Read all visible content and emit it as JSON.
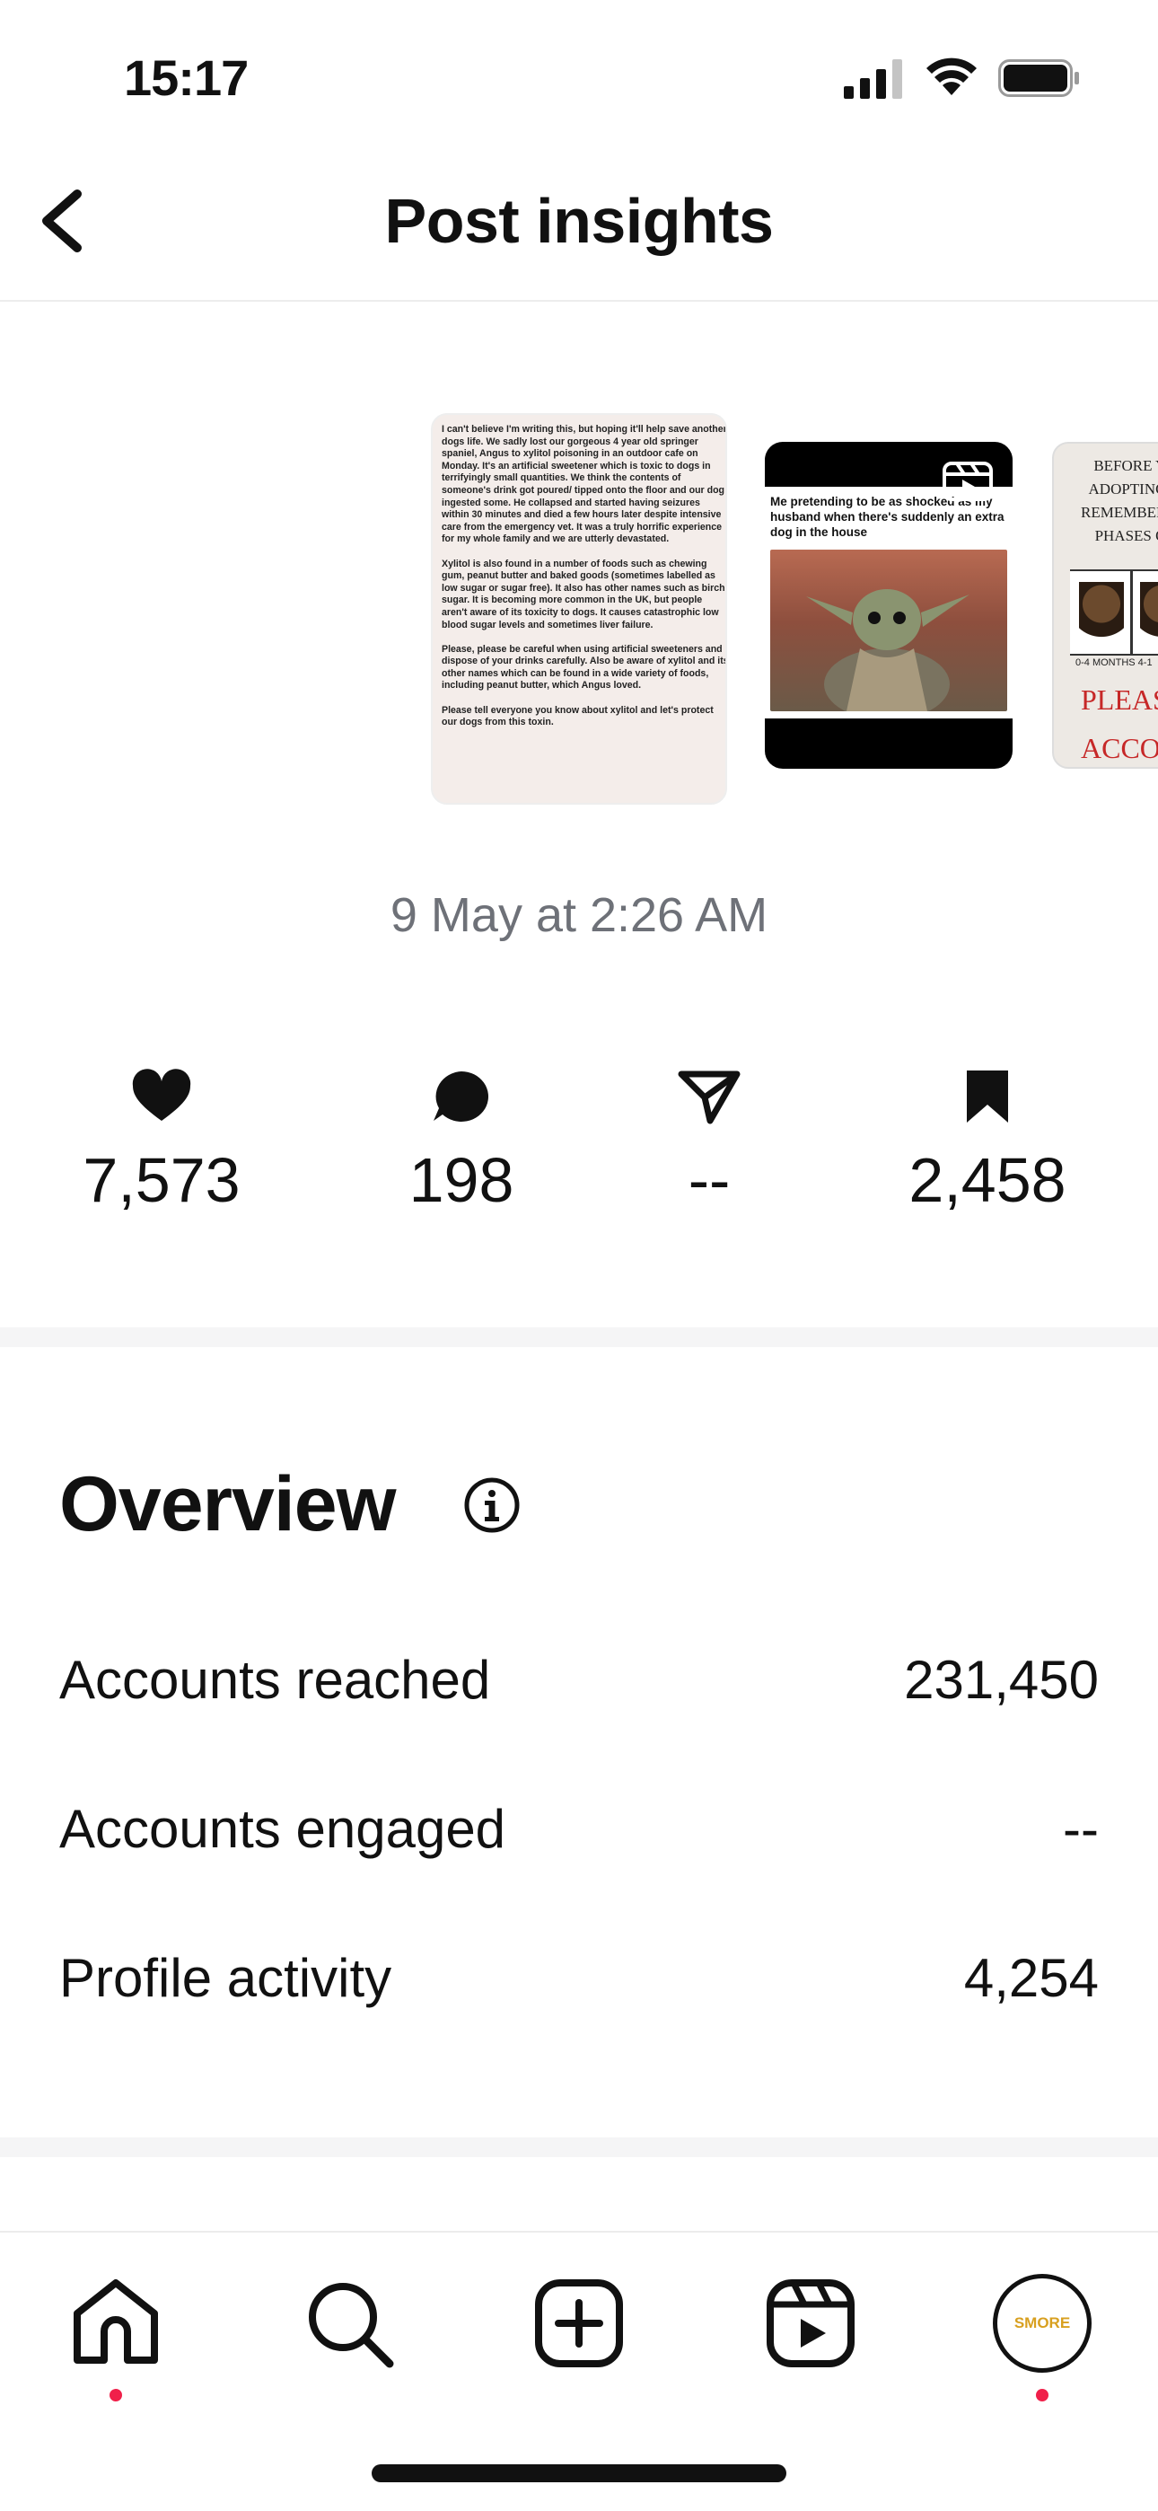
{
  "status_bar": {
    "time": "15:17"
  },
  "header": {
    "title": "Post insights"
  },
  "thumbnails": [
    {
      "text": "I can't believe I'm writing this, but hoping it'll help save another dogs life. We sadly lost our gorgeous 4 year old springer spaniel, Angus to xylitol poisoning in an outdoor cafe on Monday. It's an artificial sweetener which is toxic to dogs in terrifyingly small quantities. We think the contents of someone's drink got poured/ tipped onto the floor and our dog ingested some. He collapsed and started having seizures within 30 minutes and died a few hours later despite intensive care from the emergency vet. It was a truly horrific experience for my whole family and we are utterly devastated.\n\nXylitol is also found in a number of foods such as chewing gum, peanut butter and baked goods (sometimes labelled as low sugar or sugar free). It also has other names such as birch sugar. It is becoming more common in the UK, but people aren't aware of its toxicity to dogs. It causes catastrophic low blood sugar levels and sometimes liver failure.\n\nPlease, please be careful when using artificial sweeteners and dispose of your drinks carefully. Also be aware of xylitol and its other names which can be found in a wide variety of foods, including peanut butter, which Angus loved.\n\nPlease tell everyone you know about xylitol and let's protect our dogs from this toxin."
    },
    {
      "caption": "Me pretending to be as shocked as my husband when there's suddenly an extra dog in the house",
      "icon": "reel-icon"
    },
    {
      "text": "BEFORE Y\nADOPTING\nREMEMBER\nPHASES O",
      "age_label": "0-4 MONTHS   4-1",
      "red_text": "PLEAS\nACCOR"
    }
  ],
  "post_date": "9 May at 2:26 AM",
  "metrics": [
    {
      "icon": "heart-icon",
      "value": "7,573"
    },
    {
      "icon": "comment-icon",
      "value": "198"
    },
    {
      "icon": "share-icon",
      "value": "--"
    },
    {
      "icon": "save-icon",
      "value": "2,458"
    }
  ],
  "overview": {
    "title": "Overview",
    "rows": [
      {
        "label": "Accounts reached",
        "value": "231,450"
      },
      {
        "label": "Accounts engaged",
        "value": "--"
      },
      {
        "label": "Profile activity",
        "value": "4,254"
      }
    ]
  },
  "bottom_nav": {
    "items": [
      "home-icon",
      "search-icon",
      "create-icon",
      "reels-icon",
      "profile-avatar"
    ],
    "avatar_text": "SMORE",
    "accent": "#f0204a"
  }
}
